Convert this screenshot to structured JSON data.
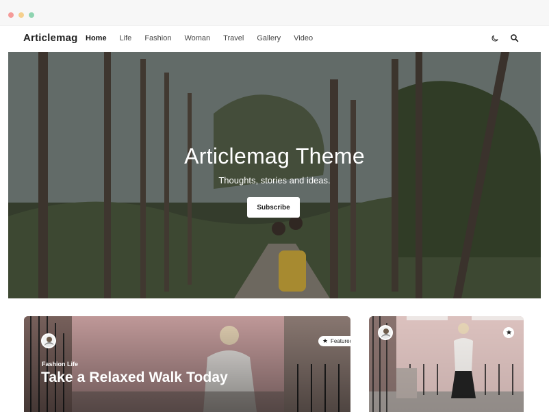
{
  "nav": {
    "brand": "Articlemag",
    "items": [
      {
        "label": "Home",
        "active": true
      },
      {
        "label": "Life",
        "active": false
      },
      {
        "label": "Fashion",
        "active": false
      },
      {
        "label": "Woman",
        "active": false
      },
      {
        "label": "Travel",
        "active": false
      },
      {
        "label": "Gallery",
        "active": false
      },
      {
        "label": "Video",
        "active": false
      }
    ],
    "icons": [
      "moon-icon",
      "search-icon"
    ]
  },
  "hero": {
    "title": "Articlemag Theme",
    "subtitle": "Thoughts, stories and ideas.",
    "button_label": "Subscribe"
  },
  "cards": [
    {
      "badge_label": "Featured",
      "badge_icon": "star-icon",
      "category": "Fashion Life",
      "title": "Take a Relaxed Walk Today"
    },
    {
      "badge_icon": "star-icon"
    }
  ],
  "colors": {
    "window_dots": [
      "#f59b99",
      "#f6d08e",
      "#8fd4b1"
    ],
    "text_dark": "#222222",
    "white": "#ffffff"
  }
}
